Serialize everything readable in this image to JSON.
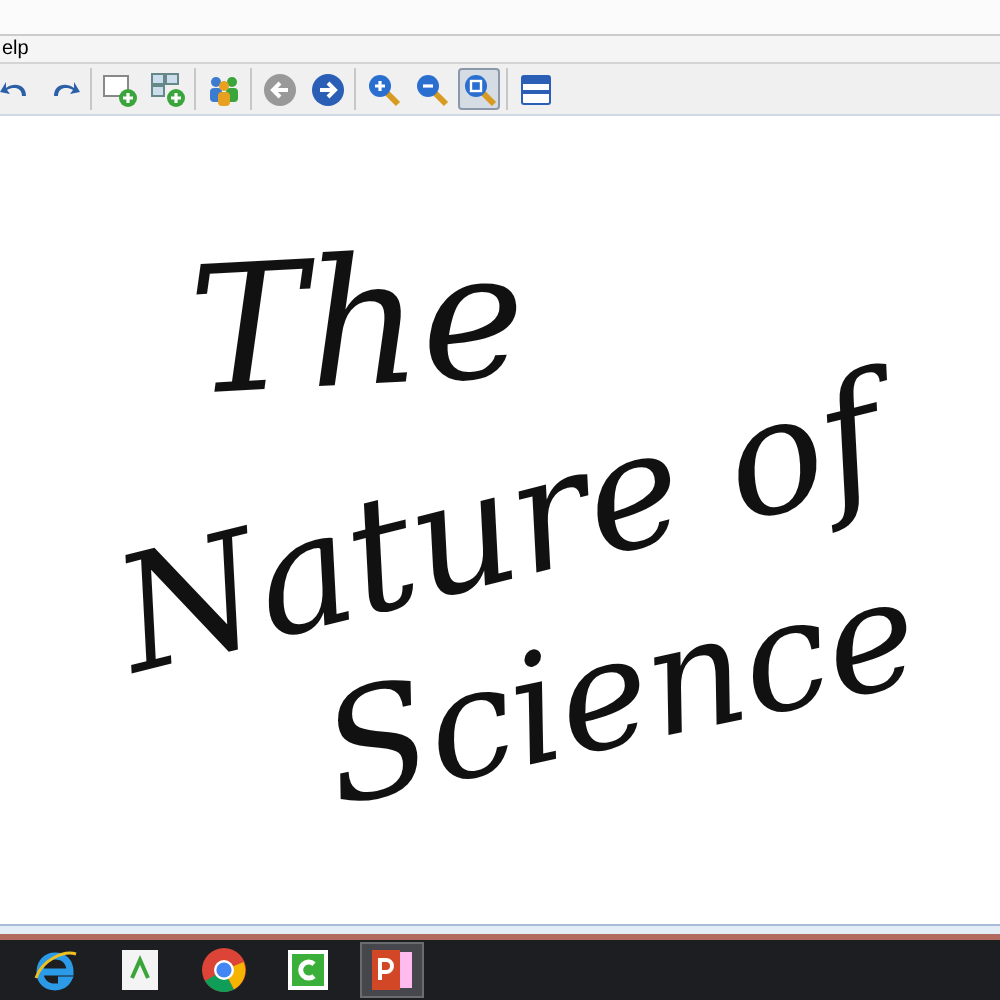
{
  "menu_bar": {
    "items": [
      "elp"
    ]
  },
  "toolbar": {
    "groups": [
      [
        {
          "kind": "undo",
          "selected": false
        },
        {
          "kind": "redo",
          "selected": false
        }
      ],
      [
        {
          "kind": "add-page",
          "selected": false
        },
        {
          "kind": "add-pages",
          "selected": false
        }
      ],
      [
        {
          "kind": "users",
          "selected": false
        }
      ],
      [
        {
          "kind": "back",
          "selected": false
        },
        {
          "kind": "forward",
          "selected": false
        }
      ],
      [
        {
          "kind": "zoom-in",
          "selected": false
        },
        {
          "kind": "zoom-out",
          "selected": false
        },
        {
          "kind": "zoom-fit",
          "selected": true
        }
      ],
      [
        {
          "kind": "window",
          "selected": false
        }
      ]
    ]
  },
  "canvas": {
    "ink_lines": [
      "The",
      "Nature of",
      "Science"
    ]
  },
  "taskbar": {
    "apps": [
      {
        "kind": "browser-e",
        "selected": false
      },
      {
        "kind": "document",
        "selected": false
      },
      {
        "kind": "browser-circle",
        "selected": false
      },
      {
        "kind": "green-c",
        "selected": false
      },
      {
        "kind": "slides",
        "selected": true
      }
    ]
  }
}
